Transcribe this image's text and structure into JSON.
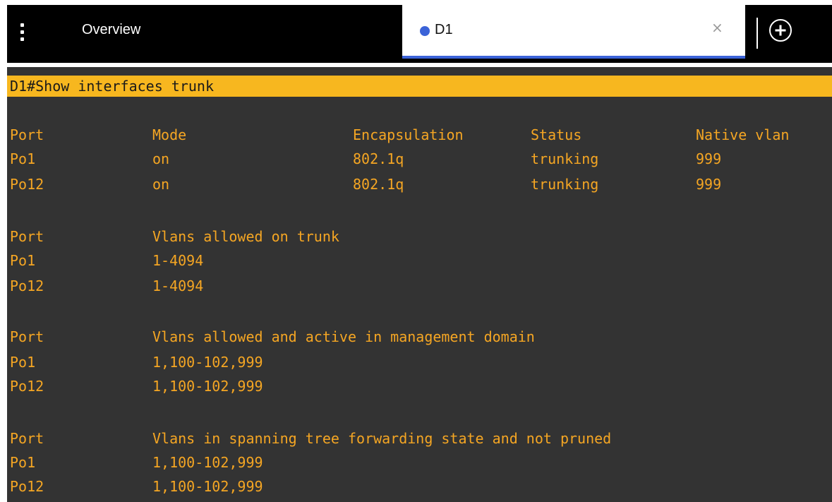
{
  "tabs": {
    "overview_label": "Overview",
    "active_label": "D1",
    "close_glyph": "×"
  },
  "colors": {
    "tab_active_accent": "#3b63d8",
    "command_highlight": "#f7b71f",
    "terminal_background": "#333333",
    "terminal_text": "#f5a623"
  },
  "terminal": {
    "command": "D1#Show interfaces trunk",
    "table1": {
      "headers": [
        "Port",
        "Mode",
        "Encapsulation",
        "Status",
        "Native vlan"
      ],
      "rows": [
        [
          "Po1",
          "on",
          "802.1q",
          "trunking",
          "999"
        ],
        [
          "Po12",
          "on",
          "802.1q",
          "trunking",
          "999"
        ]
      ]
    },
    "table2": {
      "headers": [
        "Port",
        "Vlans allowed on trunk"
      ],
      "rows": [
        [
          "Po1",
          "1-4094"
        ],
        [
          "Po12",
          "1-4094"
        ]
      ]
    },
    "table3": {
      "headers": [
        "Port",
        "Vlans allowed and active in management domain"
      ],
      "rows": [
        [
          "Po1",
          "1,100-102,999"
        ],
        [
          "Po12",
          "1,100-102,999"
        ]
      ]
    },
    "table4": {
      "headers": [
        "Port",
        "Vlans in spanning tree forwarding state and not pruned"
      ],
      "rows": [
        [
          "Po1",
          "1,100-102,999"
        ],
        [
          "Po12",
          "1,100-102,999"
        ]
      ]
    }
  }
}
